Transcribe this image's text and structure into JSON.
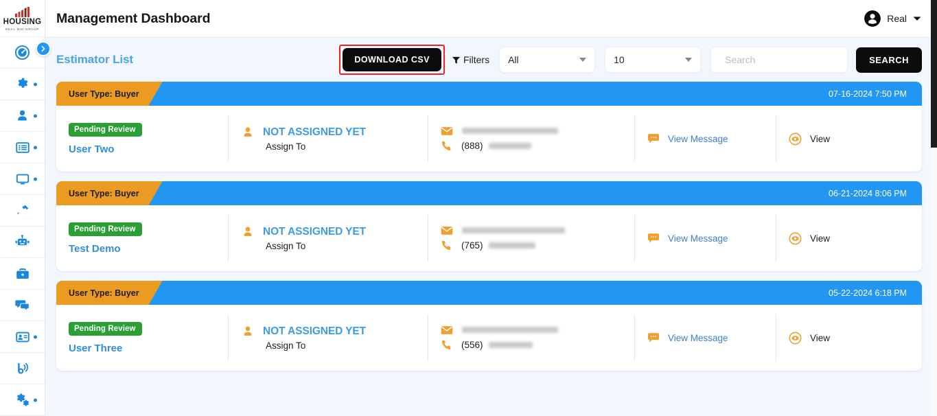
{
  "brand": {
    "name": "HOUSING",
    "tagline": "REAL BID GROUP",
    "logo_icon": "building-bars-icon",
    "accent": "#c0392b"
  },
  "header": {
    "title": "Management Dashboard",
    "user": {
      "name": "Real",
      "avatar_icon": "user-circle-icon",
      "caret_icon": "chevron-down-icon"
    }
  },
  "sidebar": {
    "toggle_icon": "chevron-right-icon",
    "items": [
      {
        "icon": "dashboard-speedometer-icon",
        "name": "dashboard",
        "dot": false
      },
      {
        "icon": "gear-icon",
        "name": "settings",
        "dot": true
      },
      {
        "icon": "person-icon",
        "name": "users",
        "dot": true
      },
      {
        "icon": "list-icon",
        "name": "lists",
        "dot": true
      },
      {
        "icon": "monitor-icon",
        "name": "monitor",
        "dot": true
      },
      {
        "icon": "hammer-icon",
        "name": "tools",
        "dot": false
      },
      {
        "icon": "robot-icon",
        "name": "automation",
        "dot": false
      },
      {
        "icon": "briefcase-icon",
        "name": "jobs",
        "dot": false
      },
      {
        "icon": "chat-bubbles-icon",
        "name": "messages",
        "dot": false
      },
      {
        "icon": "id-card-icon",
        "name": "contacts",
        "dot": true
      },
      {
        "icon": "broadcast-icon",
        "name": "broadcast",
        "dot": false
      },
      {
        "icon": "gears-icon",
        "name": "advanced-settings",
        "dot": true
      }
    ]
  },
  "toolbar": {
    "section_title": "Estimator List",
    "download_csv_label": "DOWNLOAD CSV",
    "download_csv_highlight_color": "#f42020",
    "filters_label": "Filters",
    "filters_icon": "funnel-icon",
    "type_select": {
      "value": "All",
      "caret_icon": "caret-down-icon"
    },
    "page_size_select": {
      "value": "10",
      "caret_icon": "caret-down-icon"
    },
    "search": {
      "icon": "search-icon",
      "value": "",
      "placeholder": "Search"
    },
    "search_button_label": "SEARCH"
  },
  "colors": {
    "card_header_blue": "#2196f3",
    "tag_orange": "#eb9b21",
    "badge_green": "#2aa034",
    "link_blue": "#3d9ae8",
    "page_bg": "#f2f7fd"
  },
  "labels": {
    "assign_to": "Assign To",
    "not_assigned": "NOT ASSIGNED YET",
    "view_message": "View Message",
    "view": "View",
    "status_pending": "Pending Review",
    "user_type_prefix": "User Type: Buyer"
  },
  "cards": [
    {
      "user_type": "User Type: Buyer",
      "date": "07-16-2024 7:50 PM",
      "status": "Pending Review",
      "customer_name": "User Two",
      "assignee": "NOT ASSIGNED YET",
      "assign_label": "Assign To",
      "email_redacted": true,
      "phone_area": "(888)",
      "phone_redacted": true,
      "message_label": "View Message",
      "view_label": "View"
    },
    {
      "user_type": "User Type: Buyer",
      "date": "06-21-2024 8:06 PM",
      "status": "Pending Review",
      "customer_name": "Test Demo",
      "assignee": "NOT ASSIGNED YET",
      "assign_label": "Assign To",
      "email_redacted": true,
      "phone_area": "(765)",
      "phone_redacted": true,
      "message_label": "View Message",
      "view_label": "View"
    },
    {
      "user_type": "User Type: Buyer",
      "date": "05-22-2024 6:18 PM",
      "status": "Pending Review",
      "customer_name": "User Three",
      "assignee": "NOT ASSIGNED YET",
      "assign_label": "Assign To",
      "email_redacted": true,
      "phone_area": "(556)",
      "phone_redacted": true,
      "message_label": "View Message",
      "view_label": "View"
    }
  ],
  "icons": {
    "email": "envelope-icon",
    "phone": "phone-icon",
    "person": "person-icon",
    "message": "chat-bubble-icon",
    "view": "eye-icon"
  }
}
